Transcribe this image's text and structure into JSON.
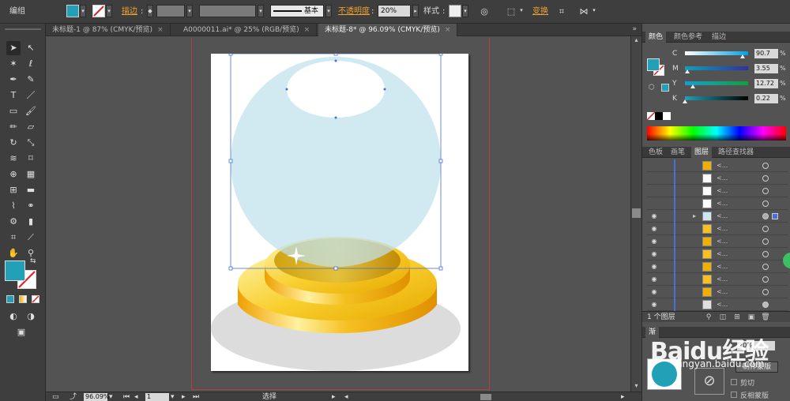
{
  "control_bar": {
    "mode_label": "编组",
    "stroke_label": "描边",
    "stroke_style": "基本",
    "opacity_label": "不透明度",
    "opacity_value": "20%",
    "style_label": "样式",
    "transform_label": "变换",
    "fill_color": "#22a0b8"
  },
  "tabs": [
    {
      "label": "未标题-1 @ 87% (CMYK/预览)",
      "close": "×"
    },
    {
      "label": "A0000011.ai* @ 25% (RGB/预览)",
      "close": "×"
    },
    {
      "label": "未标题-8* @ 96.09% (CMYK/预览)",
      "close": "×"
    }
  ],
  "status_bar": {
    "zoom": "96.09%",
    "artboard": "1",
    "tool": "选择"
  },
  "color_panel": {
    "tabs": [
      "颜色",
      "颜色参考",
      "描边"
    ],
    "channels": [
      {
        "label": "C",
        "value": "90.7",
        "fraction": 0.907
      },
      {
        "label": "M",
        "value": "3.55",
        "fraction": 0.0355
      },
      {
        "label": "Y",
        "value": "12.72",
        "fraction": 0.1272
      },
      {
        "label": "K",
        "value": "0.22",
        "fraction": 0.0022
      }
    ],
    "percent": "%"
  },
  "layers_panel": {
    "tabs": [
      "色板",
      "画笔",
      "图层",
      "路径查找器"
    ],
    "row_label": "<...",
    "count_label": "1 个图层"
  },
  "transparency_panel": {
    "title": "渐",
    "opacity_value": "20%",
    "make_mask_label": "制作蒙版",
    "clip_label": "剪切",
    "invert_label": "反相蒙版"
  },
  "watermark": {
    "text": "Baidu经验",
    "url": "jingyan.baidu.com"
  }
}
